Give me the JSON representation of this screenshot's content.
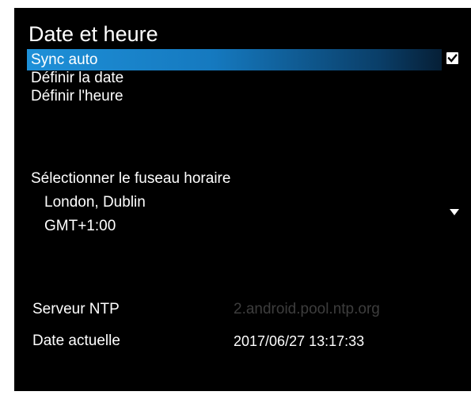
{
  "screen": {
    "title": "Date et heure"
  },
  "menu": {
    "sync_auto": "Sync auto",
    "sync_auto_checked": true,
    "set_date": "Définir la date",
    "set_time": "Définir l'heure"
  },
  "timezone": {
    "label": "Sélectionner le fuseau horaire",
    "city": "London, Dublin",
    "offset": "GMT+1:00",
    "dropdown_icon": "triangle-down-icon"
  },
  "info": {
    "ntp_label": "Serveur NTP",
    "ntp_value": "2.android.pool.ntp.org",
    "current_date_label": "Date actuelle",
    "current_date_value": "2017/06/27 13:17:33"
  },
  "colors": {
    "background": "#000000",
    "text": "#ffffff",
    "highlight": "#1e90d8",
    "disabled_text": "#3d3d3d"
  }
}
